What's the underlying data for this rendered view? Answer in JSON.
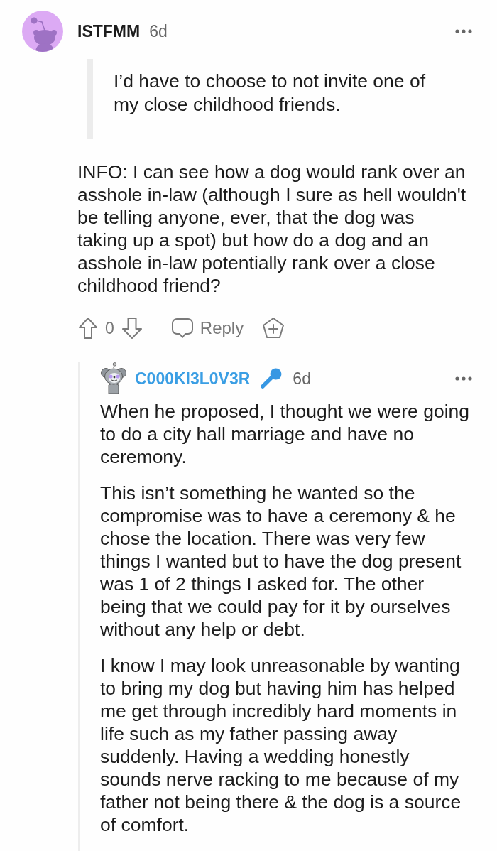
{
  "comment": {
    "author": "ISTFMM",
    "age": "6d",
    "quote": "I’d have to choose to not invite one of my close childhood friends.",
    "body": "INFO: I can see how a dog would rank over an asshole in-law (although I sure as hell wouldn't be telling anyone, ever, that the dog was taking up a spot) but how do a dog and an asshole in-law potentially rank over a close childhood friend?",
    "votes": "0",
    "reply_label": "Reply"
  },
  "reply": {
    "author": "C000KI3L0V3R",
    "age": "6d",
    "paragraphs": [
      "When he proposed, I thought we were going to do a city hall marriage and have no ceremony.",
      "This isn’t something he wanted so the compromise was to have a ceremony & he chose the location. There was very few things I wanted but to have the dog present was 1 of 2 things I asked for. The other being that we could pay for it by ourselves without any help or debt.",
      "I know I may look unreasonable by wanting to bring my dog but having him has helped me get through incredibly hard moments in life such as my father passing away suddenly. Having a wedding honestly sounds nerve racking to me because of my father not being there & the dog is a source of comfort."
    ]
  }
}
